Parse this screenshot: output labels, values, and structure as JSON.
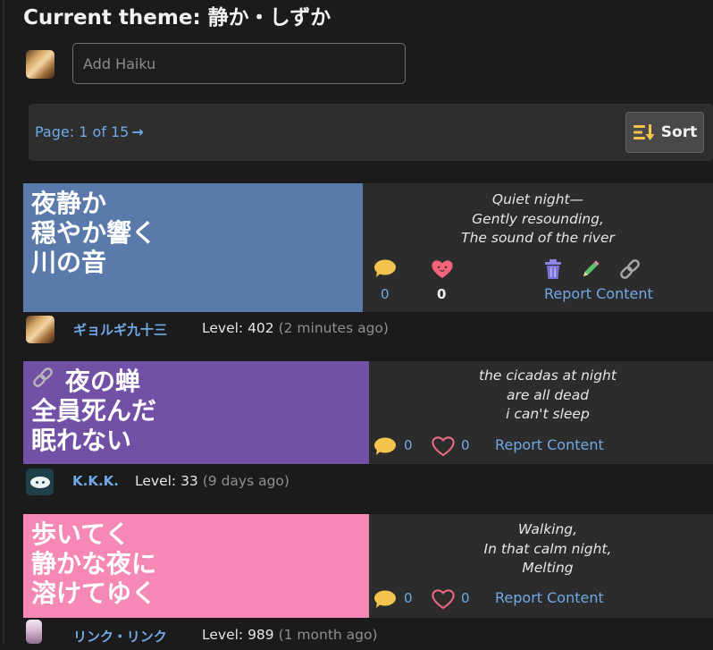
{
  "theme": {
    "label": "Current theme: 静か・しずか"
  },
  "composer": {
    "placeholder": "Add Haiku"
  },
  "pager": {
    "text": "Page: 1 of 15",
    "arrow": "→"
  },
  "sort": {
    "label": "Sort",
    "icon": "sort-descending-icon"
  },
  "colors": {
    "accent": "#70a9e6",
    "background": "#1b1b1b",
    "panel": "#2c2c2c"
  },
  "haikus": [
    {
      "color": "#5a7aab",
      "japanese": "夜静か\n穏やか響く\n川の音",
      "english": "Quiet night—\nGently resounding,\nThe sound of the river",
      "comments": "0",
      "likes": "0",
      "report": "Report Content",
      "owner_actions": [
        "trash-icon",
        "edit-pencil-icon",
        "link-icon"
      ],
      "author": "ギョルギ九十三",
      "level": "Level: 402",
      "time": "(2 minutes ago)"
    },
    {
      "color": "#7150a6",
      "japanese": "夜の蝉\n全員死んだ\n眠れない",
      "english": "the cicadas at night\nare all dead\ni can't sleep",
      "comments": "0",
      "likes": "0",
      "report": "Report Content",
      "author": "K.K.K.",
      "level": "Level: 33",
      "time": "(9 days ago)"
    },
    {
      "color": "#f588b4",
      "japanese": "歩いてく\n静かな夜に\n溶けてゆく",
      "english": "Walking,\nIn that calm night,\nMelting",
      "comments": "0",
      "likes": "0",
      "report": "Report Content",
      "author": "リンク・リンク",
      "level": "Level: 989",
      "time": "(1 month ago)"
    }
  ]
}
